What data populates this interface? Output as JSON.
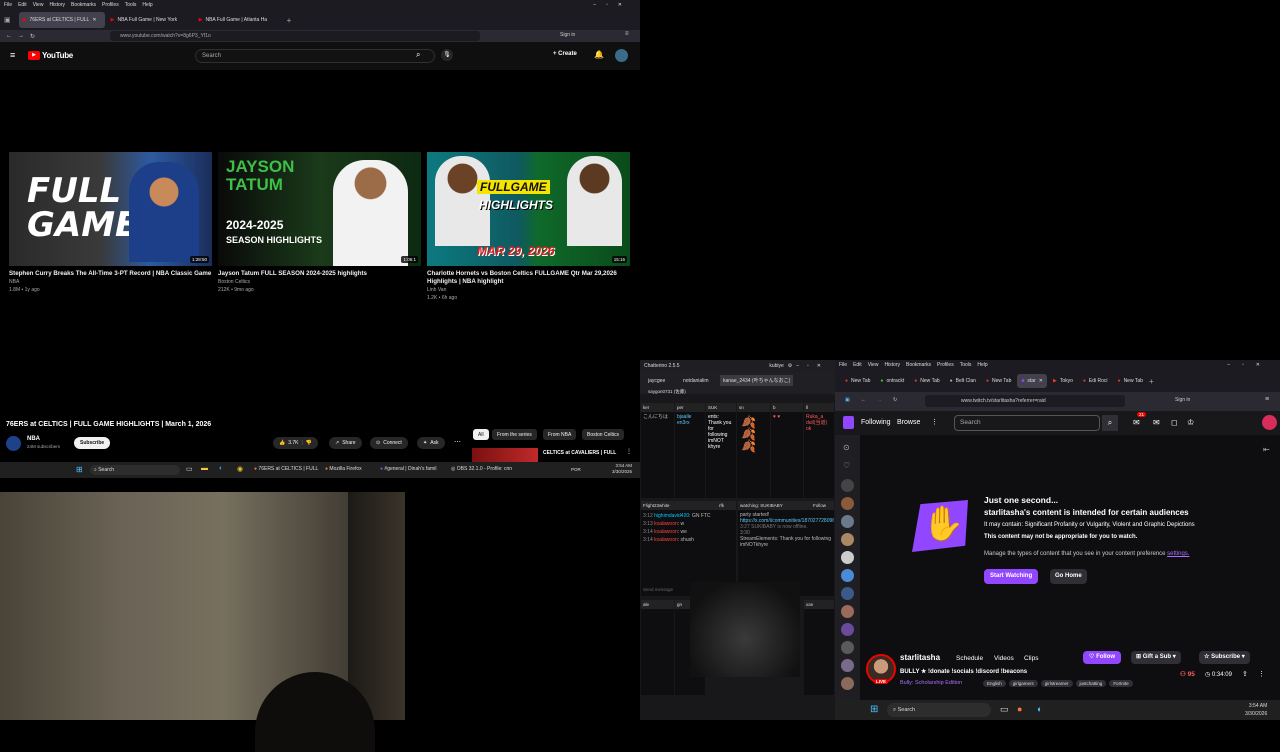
{
  "firefox": {
    "menu": [
      "File",
      "Edit",
      "View",
      "History",
      "Bookmarks",
      "Profiles",
      "Tools",
      "Help"
    ],
    "tabs": [
      {
        "label": "76ERS at CELTICS | FULL",
        "active": true
      },
      {
        "label": "NBA Full Game | New York",
        "active": false
      },
      {
        "label": "NBA Full Game | Atlanta Ha",
        "active": false
      }
    ],
    "url": "www.youtube.com/watch?v=8g6P3_Yf1o",
    "signin": "Sign in"
  },
  "youtube": {
    "logo": "YouTube",
    "search_placeholder": "Search",
    "create": "Create",
    "videos": [
      {
        "thumb_text": "FULL GAME",
        "title": "Stephen Curry Breaks The All-Time 3-PT Record | NBA Classic Game",
        "channel": "NBA",
        "meta": "1.8M • 1y ago",
        "duration": "1:28:50"
      },
      {
        "thumb_text_1": "JAYSON",
        "thumb_text_2": "TATUM",
        "thumb_text_3": "2024-2025",
        "thumb_text_4": "SEASON HIGHLIGHTS",
        "title": "Jayson Tatum FULL SEASON 2024-2025 highlights",
        "channel": "Boston Celtics",
        "meta": "212K • 9mo ago",
        "duration": "1:06:1"
      },
      {
        "thumb_text_1": "FULLGAME",
        "thumb_text_2": "HIGHLIGHTS",
        "thumb_text_3": "MAR 29, 2026",
        "title": "Charlotte Hornets vs Boston Celtics FULLGAME Qtr Mar 29,2026 Highlights | NBA highlight",
        "channel": "Linh Van",
        "meta": "1.2K • 6h ago",
        "duration": "15:16"
      }
    ],
    "watch_title": "76ERS at CELTICS | FULL GAME HIGHLIGHTS | March 1, 2026",
    "channel": "NBA",
    "subs": "24M subscribers",
    "subscribe": "Subscribe",
    "likes": "3.7K",
    "share": "Share",
    "connect": "Connect",
    "ask": "Ask",
    "chips": [
      "All",
      "From the series",
      "From NBA",
      "Boston Celtics"
    ],
    "rec_title": "CELTICS at CAVALIERS | FULL"
  },
  "taskbar1": {
    "search": "Search",
    "apps": [
      "76ERS at CELTICS | FULL",
      "Mozilla Firefox",
      "#general | Dinah's famil",
      "OBS 32.1.0 - Profile: cnn"
    ],
    "time": "3:54 AM",
    "date": "3/30/2026",
    "lang": "POR"
  },
  "chatterino": {
    "title": "Chatterino 2.5.5",
    "user": "kubiye",
    "tabs": [
      "jaycgee",
      "notdanialim",
      "kanae_2434 (叶ちゃんなおこ)",
      "saygon0731 (佐藤)"
    ],
    "col_heads": [
      "ker",
      "per",
      "SUK",
      "sn",
      "b",
      "ll",
      "ol",
      "Flight23white",
      "rfk",
      "watching: SUKIBABY",
      "Follow",
      "ale",
      "gn",
      "xan"
    ],
    "messages": [
      {
        "time": "3:12",
        "user": "highimdavid420",
        "text": "GN FTC"
      },
      {
        "time": "3:13",
        "user": "kvalawoon",
        "text": "w"
      },
      {
        "time": "3:14",
        "user": "kvalawoon",
        "text": "we"
      },
      {
        "time": "3:14",
        "user": "kvalawoon",
        "text": "shush"
      }
    ],
    "suki_msgs": [
      "party started!",
      "https://x.com/i/communities/1870277280969406340",
      "3:27 SUKIBABY is now offline.",
      "3:30",
      "StreamElements: Thank you for following imNOTkhyre"
    ],
    "send_placeholder": "Send message",
    "chat_snips": [
      "ents: Thank you for following imNOT khyre",
      "Ruka_a dull(当道) ok",
      "bjaalle en3rx",
      "こんにちは"
    ]
  },
  "twitch": {
    "menu": [
      "File",
      "Edit",
      "View",
      "History",
      "Bookmarks",
      "Profiles",
      "Tools",
      "Help"
    ],
    "tabs": [
      "New Tab",
      "ontrackt",
      "New Tab",
      "Belt Clan",
      "New Tab",
      "star",
      "Tokyo",
      "Edi Roci",
      "New Tab"
    ],
    "url": "www.twitch.tv/starlitasha?referrer=raid",
    "signin": "Sign in",
    "following": "Following",
    "browse": "Browse",
    "search": "Search",
    "notif": "21",
    "warn_title": "Just one second...",
    "warn_sub": "starlitasha's content is intended for certain audiences",
    "warn_may": "It may contain: Significant Profanity or Vulgarity, Violent and Graphic Depictions",
    "warn_note": "This content may not be appropriate for you to watch.",
    "warn_manage": "Manage the types of content that you see in your content preference",
    "settings": "settings.",
    "start": "Start Watching",
    "go_home": "Go Home",
    "streamer": "starlitasha",
    "nav": [
      "Schedule",
      "Videos",
      "Clips"
    ],
    "follow": "Follow",
    "gift": "Gift a Sub",
    "subscribe": "Subscribe",
    "stream_title": "BULLY ★ !donate !socials !discord !beacons",
    "game": "Bully: Scholarship Edition",
    "tags": [
      "English",
      "girlgamers",
      "girlstreamer",
      "justchatting",
      "Fortnite"
    ],
    "viewers": "95",
    "uptime": "0:34:09",
    "live": "LIVE"
  },
  "taskbar2": {
    "search": "Search",
    "time": "3:54 AM",
    "date": "3/30/2026"
  }
}
